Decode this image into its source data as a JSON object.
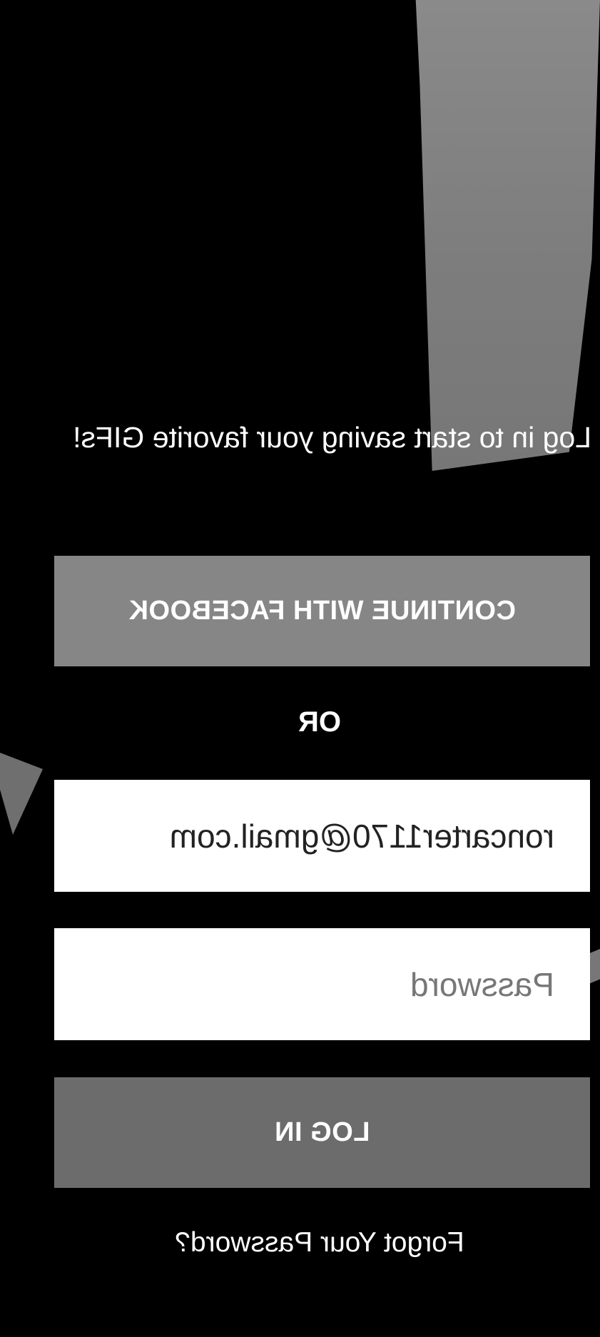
{
  "login": {
    "tagline": "Log in to start saving your favorite GIFs!",
    "facebook_button": "CONTINUE WITH FACEBOOK",
    "divider": "OR",
    "email_value": "roncarter1170@gmail.com",
    "password_placeholder": "Password",
    "login_button": "LOG IN",
    "forgot_link": "Forgot Your Password?"
  },
  "colors": {
    "background": "#000000",
    "facebook_button": "#868686",
    "login_button": "#6c6c6c",
    "field_background": "#ffffff"
  }
}
